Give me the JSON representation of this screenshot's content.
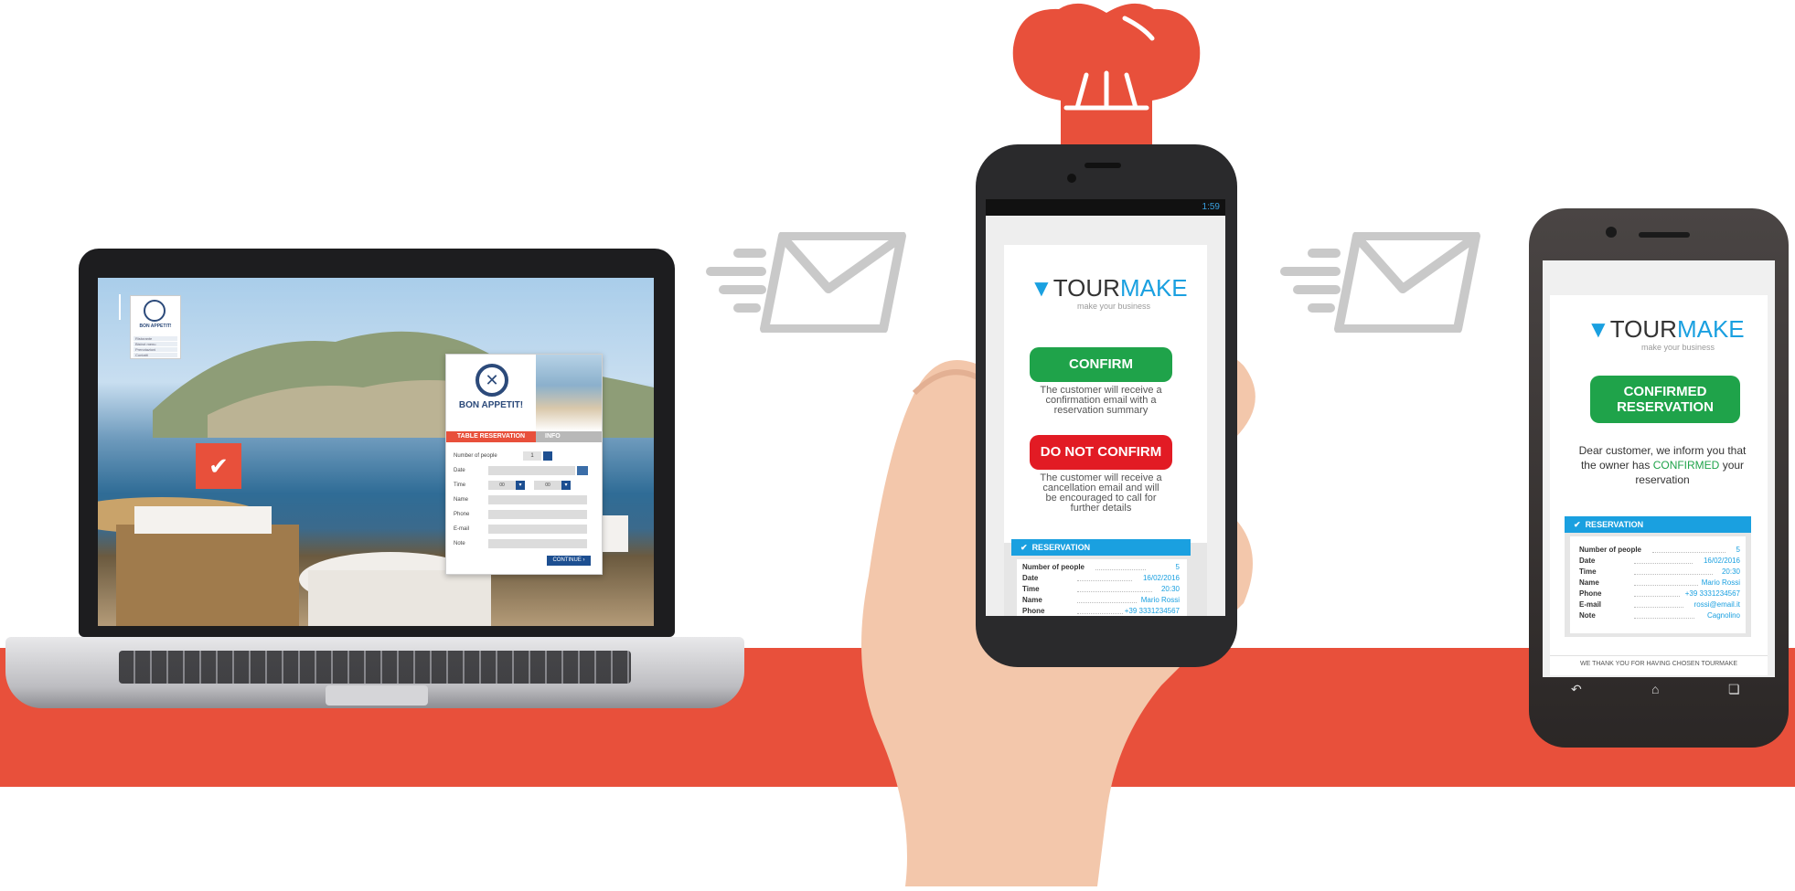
{
  "colors": {
    "accent_red": "#e8503b",
    "tourmake_blue": "#1aa0e0",
    "confirm_green": "#1fa34a",
    "reject_red": "#e21b24",
    "navy": "#1d4f91"
  },
  "laptop": {
    "mini_logo": {
      "name": "BON APPETIT!",
      "rows": [
        "Ristorante",
        "Bistrot menu",
        "Prenotazioni",
        "Contatti"
      ]
    },
    "table_icon": "table-check-icon",
    "form": {
      "restaurant_name": "BON APPETIT!",
      "tab_reservation": "TABLE RESERVATION",
      "tab_info": "INFO",
      "fields": {
        "people_label": "Number of people",
        "people_value": "1",
        "date_label": "Date",
        "time_label": "Time",
        "time_hours": "00",
        "time_minutes": "00",
        "name_label": "Name",
        "phone_label": "Phone",
        "email_label": "E-mail",
        "note_label": "Note"
      },
      "continue_label": "CONTINUE ›"
    }
  },
  "phone_owner": {
    "status_time": "1:59",
    "logo_brand_a": "TOUR",
    "logo_brand_b": "MAKE",
    "tagline": "make your business",
    "confirm_button": "CONFIRM",
    "confirm_desc": "The customer will receive a confirmation email with a reservation summary",
    "reject_button": "DO NOT CONFIRM",
    "reject_desc": "The customer will receive a cancellation email and will be encouraged to call for further details",
    "reservation_header": "RESERVATION",
    "rows": [
      {
        "label": "Number of people",
        "value": "5"
      },
      {
        "label": "Date",
        "value": "16/02/2016"
      },
      {
        "label": "Time",
        "value": "20:30"
      },
      {
        "label": "Name",
        "value": "Mario Rossi"
      },
      {
        "label": "Phone",
        "value": "+39 3331234567"
      }
    ]
  },
  "phone_customer": {
    "logo_brand_a": "TOUR",
    "logo_brand_b": "MAKE",
    "tagline": "make your business",
    "status_line1": "CONFIRMED",
    "status_line2": "RESERVATION",
    "message_a": "Dear customer, we inform you that the owner has",
    "message_highlight": "CONFIRMED",
    "message_b": "your reservation",
    "reservation_header": "RESERVATION",
    "rows": [
      {
        "label": "Number of people",
        "value": "5"
      },
      {
        "label": "Date",
        "value": "16/02/2016"
      },
      {
        "label": "Time",
        "value": "20:30"
      },
      {
        "label": "Name",
        "value": "Mario Rossi"
      },
      {
        "label": "Phone",
        "value": "+39 3331234567"
      },
      {
        "label": "E-mail",
        "value": "rossi@email.it"
      },
      {
        "label": "Note",
        "value": "Cagnolino"
      }
    ],
    "footer": "WE THANK YOU FOR HAVING CHOSEN TOURMAKE",
    "nav_icons": [
      "back-icon",
      "home-icon",
      "recent-apps-icon"
    ]
  }
}
